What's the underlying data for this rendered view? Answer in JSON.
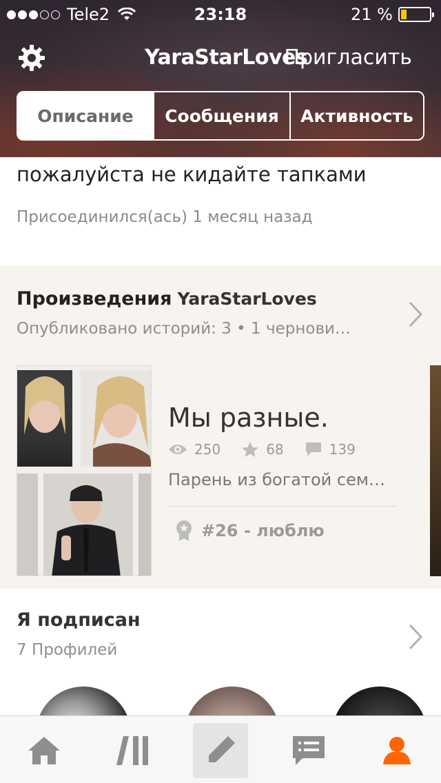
{
  "status_bar": {
    "carrier": "Tele2",
    "time": "23:18",
    "battery_percent": "21 %",
    "battery_level": 0.21
  },
  "nav": {
    "title": "YaraStarLoves",
    "invite_label": "Пригласить",
    "settings_icon": "gear-icon"
  },
  "tabs": [
    {
      "label": "Описание",
      "active": true
    },
    {
      "label": "Сообщения",
      "active": false
    },
    {
      "label": "Активность",
      "active": false
    }
  ],
  "description": {
    "text": "пожалуйста не кидайте тапками",
    "joined": "Присоединился(ась) 1 месяц назад"
  },
  "works": {
    "title": "Произведения",
    "username": "YaraStarLoves",
    "subtitle": "Опубликовано историй: 3 • 1 чернови…",
    "story": {
      "title": "Мы разные.",
      "views": "250",
      "votes": "68",
      "comments": "139",
      "description": "Парень из богатой сем…",
      "rank": "#26 - люблю"
    }
  },
  "following": {
    "title": "Я подписан",
    "count": "7 Профилей"
  },
  "tabbar": {
    "items": [
      "home-icon",
      "library-icon",
      "write-icon",
      "messages-icon",
      "profile-icon"
    ],
    "active_color": "#ff6600"
  }
}
